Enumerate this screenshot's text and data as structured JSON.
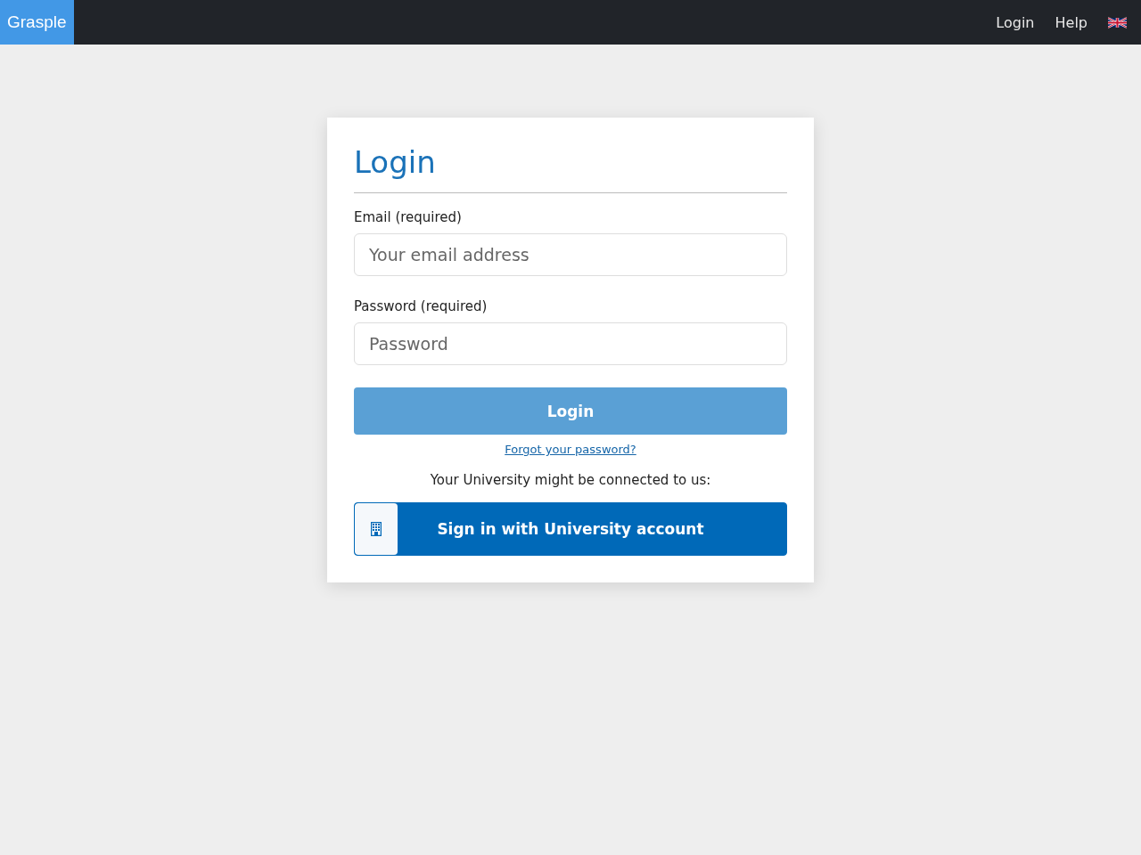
{
  "navbar": {
    "brand": "Grasple",
    "links": [
      "Login",
      "Help"
    ]
  },
  "login": {
    "title": "Login",
    "fields": [
      {
        "label": "Email (required)",
        "placeholder": "Your email address"
      },
      {
        "label": "Password (required)",
        "placeholder": "Password"
      }
    ],
    "submit": "Login",
    "submit_disabled": true,
    "forgot_link": "Forgot your password?",
    "sso_note": "Your University might be connected to us:",
    "sso_button": "Sign in with University account"
  }
}
